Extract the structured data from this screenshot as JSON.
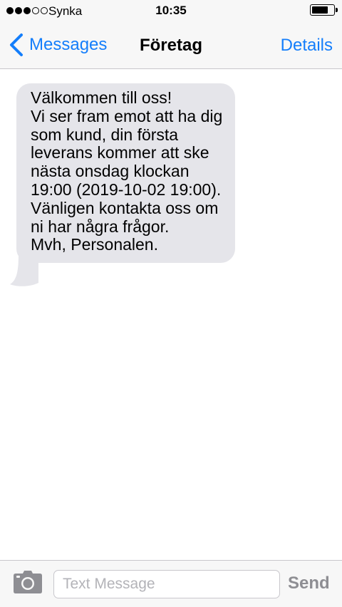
{
  "status_bar": {
    "signal": {
      "filled": 3,
      "total": 5
    },
    "carrier": "Synka",
    "time": "10:35",
    "battery_level": 0.75
  },
  "nav": {
    "back_label": "Messages",
    "title": "Företag",
    "details_label": "Details"
  },
  "conversation": {
    "messages": [
      {
        "direction": "incoming",
        "text": "Välkommen till oss!\nVi ser fram emot att ha dig som kund, din första leverans kommer att ske nästa onsdag klockan 19:00 (2019-10-02 19:00).\nVänligen kontakta oss om ni har några frågor.\nMvh, Personalen."
      }
    ]
  },
  "input_bar": {
    "placeholder": "Text Message",
    "value": "",
    "send_label": "Send"
  },
  "colors": {
    "accent": "#147efb",
    "bubble_incoming": "#e5e5ea",
    "bar_background": "#f7f7f7",
    "send_disabled": "#8e8e93"
  },
  "icons": {
    "back": "chevron-left-icon",
    "camera": "camera-icon"
  }
}
